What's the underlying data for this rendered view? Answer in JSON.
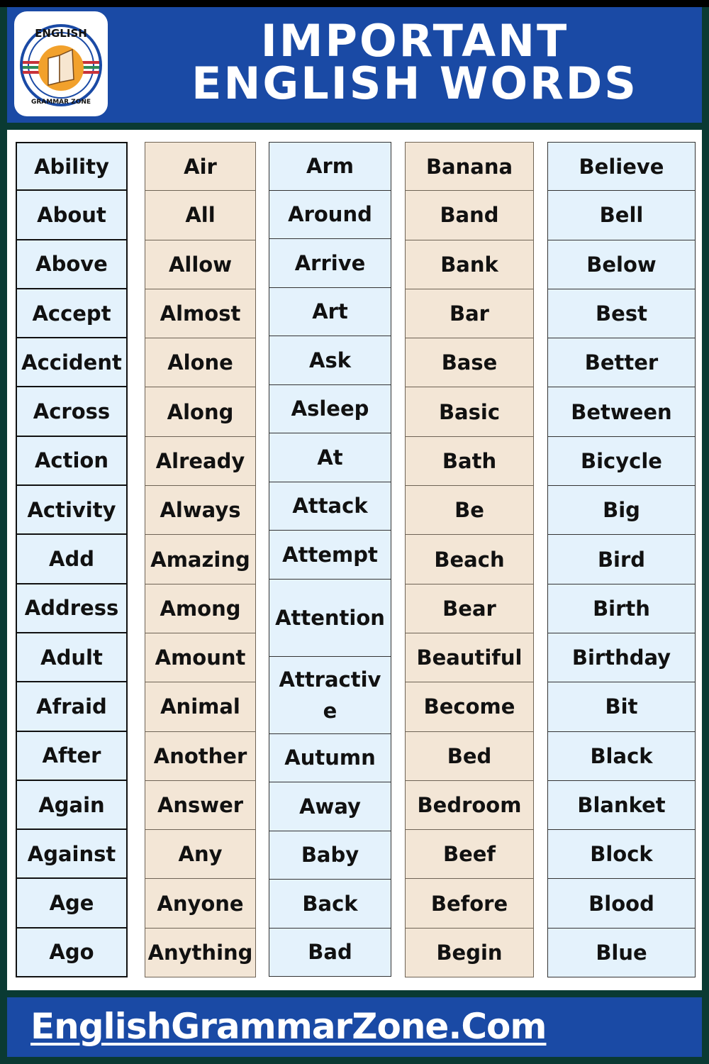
{
  "header": {
    "logo": {
      "top_text": "ENGLISH",
      "bottom_text": "GRAMMAR ZONE",
      "icon": "book-icon"
    },
    "title_line1": "IMPORTANT",
    "title_line2": "ENGLISH WORDS"
  },
  "colors": {
    "header_blue": "#1a4aa5",
    "frame_green": "#0a3a33",
    "cell_blue": "#e4f2fc",
    "cell_tan": "#f3e6d6"
  },
  "columns": [
    {
      "words": [
        "Ability",
        "About",
        "Above",
        "Accept",
        "Accident",
        "Across",
        "Action",
        "Activity",
        "Add",
        "Address",
        "Adult",
        "Afraid",
        "After",
        "Again",
        "Against",
        "Age",
        "Ago"
      ]
    },
    {
      "words": [
        "Air",
        "All",
        "Allow",
        "Almost",
        "Alone",
        "Along",
        "Already",
        "Always",
        "Amazing",
        "Among",
        "Amount",
        "Animal",
        "Another",
        "Answer",
        "Any",
        "Anyone",
        "Anything"
      ]
    },
    {
      "words": [
        "Arm",
        "Around",
        "Arrive",
        "Art",
        "Ask",
        "Asleep",
        "At",
        "Attack",
        "Attempt",
        "Attention",
        "Attractive",
        "Autumn",
        "Away",
        "Baby",
        "Back",
        "Bad"
      ]
    },
    {
      "words": [
        "Banana",
        "Band",
        "Bank",
        "Bar",
        "Base",
        "Basic",
        "Bath",
        "Be",
        "Beach",
        "Bear",
        "Beautiful",
        "Become",
        "Bed",
        "Bedroom",
        "Beef",
        "Before",
        "Begin"
      ]
    },
    {
      "words": [
        "Believe",
        "Bell",
        "Below",
        "Best",
        "Better",
        "Between",
        "Bicycle",
        "Big",
        "Bird",
        "Birth",
        "Birthday",
        "Bit",
        "Black",
        "Blanket",
        "Block",
        "Blood",
        "Blue"
      ]
    }
  ],
  "footer": {
    "site": "EnglishGrammarZone.Com"
  }
}
